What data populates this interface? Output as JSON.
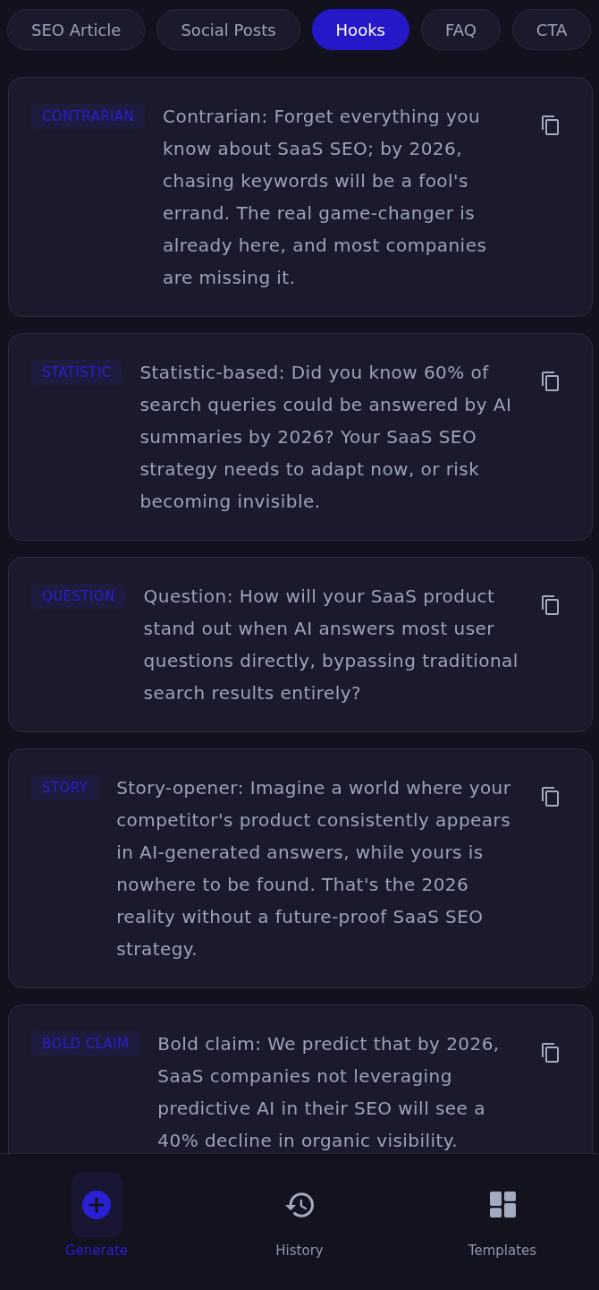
{
  "tabs": [
    {
      "label": "SEO Article",
      "selected": false
    },
    {
      "label": "Social Posts",
      "selected": false
    },
    {
      "label": "Hooks",
      "selected": true
    },
    {
      "label": "FAQ",
      "selected": false
    },
    {
      "label": "CTA",
      "selected": false
    }
  ],
  "hooks": [
    {
      "tag": "CONTRARIAN",
      "text": "Contrarian: Forget everything you know about SaaS SEO; by 2026, chasing keywords will be a fool's errand. The real game-changer is already here, and most companies are missing it."
    },
    {
      "tag": "STATISTIC",
      "text": "Statistic-based: Did you know 60% of search queries could be answered by AI summaries by 2026? Your SaaS SEO strategy needs to adapt now, or risk becoming invisible."
    },
    {
      "tag": "QUESTION",
      "text": "Question: How will your SaaS product stand out when AI answers most user questions directly, bypassing traditional search results entirely?"
    },
    {
      "tag": "STORY",
      "text": "Story-opener: Imagine a world where your competitor's product consistently appears in AI-generated answers, while yours is nowhere to be found. That's the 2026 reality without a future-proof SaaS SEO strategy."
    },
    {
      "tag": "BOLD CLAIM",
      "text": "Bold claim: We predict that by 2026, SaaS companies not leveraging predictive AI in their SEO will see a 40% decline in organic visibility."
    }
  ],
  "bottom_nav": [
    {
      "label": "Generate",
      "selected": true
    },
    {
      "label": "History",
      "selected": false
    },
    {
      "label": "Templates",
      "selected": false
    }
  ]
}
